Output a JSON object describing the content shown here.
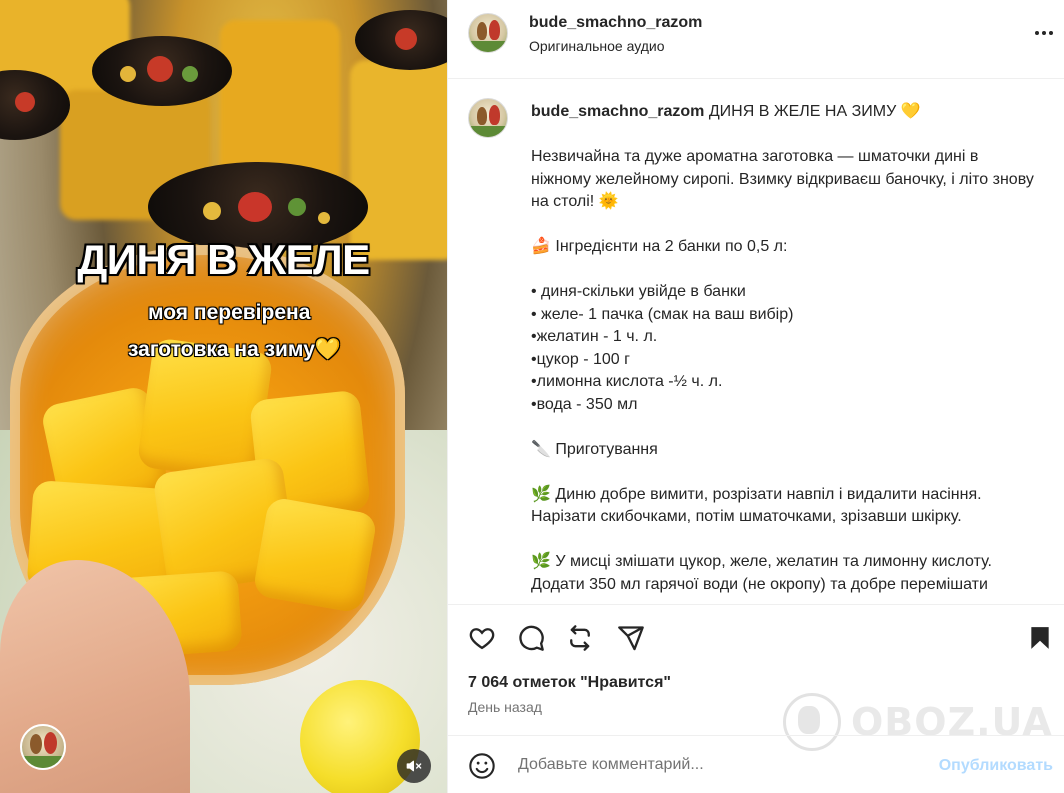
{
  "media": {
    "overlay_title": "ДИНЯ В ЖЕЛЕ",
    "overlay_line1": "моя перевірена",
    "overlay_line2": "заготовка на зиму",
    "overlay_heart": "💛"
  },
  "header": {
    "username": "bude_smachno_razom",
    "audio": "Оригинальное аудио"
  },
  "caption": {
    "username": "bude_smachno_razom",
    "title": " ДИНЯ В ЖЕЛЕ НА ЗИМУ 💛",
    "lines": [
      "",
      "Незвичайна та дуже ароматна заготовка — шматочки дині в ніжному желейному сиропі. Взимку відкриваєш баночку, і літо знову на столі! 🌞",
      "",
      "🍰 Інгредієнти на 2 банки по 0,5 л:",
      "",
      "• диня-скільки увійде в банки",
      "• желе- 1 пачка (смак на ваш вибір)",
      "•желатин - 1 ч. л.",
      "•цукор - 100 г",
      "•лимонна кислота -½ ч. л.",
      "•вода - 350 мл",
      "",
      "🔪 Приготування",
      "",
      "🌿 Диню добре вимити, розрізати навпіл і видалити насіння. Нарізати скибочками, потім шматочками, зрізавши шкірку.",
      "",
      "🌿 У мисці змішати цукор, желе, желатин та лимонну кислоту. Додати 350 мл гарячої води (не окропу) та добре перемішати"
    ]
  },
  "stats": {
    "likes": "7 064 отметок \"Нравится\"",
    "time": "День назад"
  },
  "comment": {
    "placeholder": "Добавьте комментарий...",
    "publish_label": "Опубликовать"
  },
  "watermark": {
    "brand": "OBOZ.UA"
  },
  "icons": [
    "heart-icon",
    "comment-icon",
    "repost-icon",
    "share-icon",
    "bookmark-icon",
    "emoji-icon",
    "mute-icon",
    "more-icon"
  ],
  "colors": {
    "publish_disabled": "#b3dbff",
    "text": "#262626",
    "secondary": "#737373"
  }
}
